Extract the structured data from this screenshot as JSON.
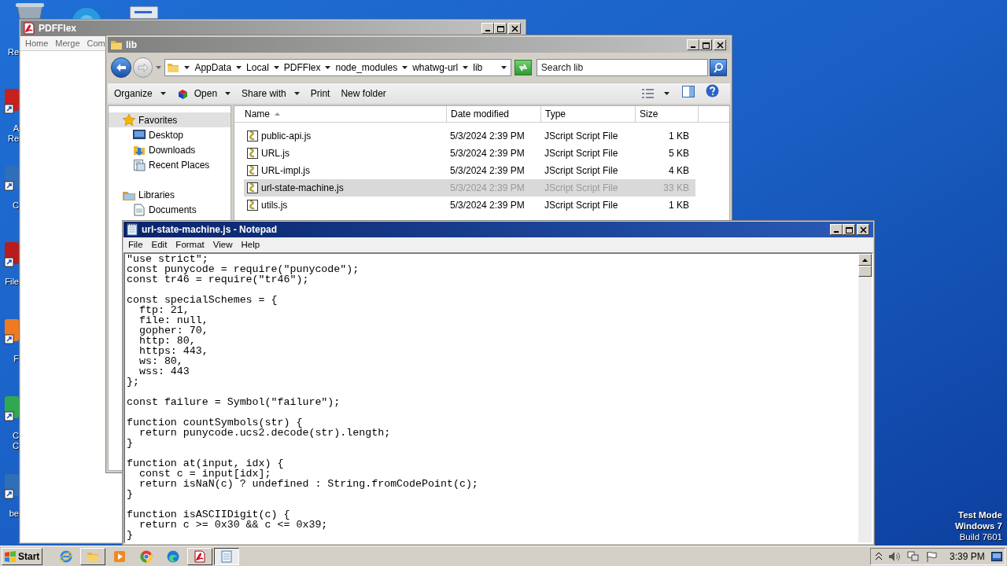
{
  "desktop": {
    "icons": [
      {
        "lines": [
          "Re"
        ]
      },
      {
        "lines": [
          "A",
          "Re"
        ]
      },
      {
        "lines": [
          "C"
        ]
      },
      {
        "lines": [
          "File"
        ]
      },
      {
        "lines": [
          "F"
        ]
      },
      {
        "lines": [
          "C",
          "C"
        ]
      },
      {
        "lines": [
          "be"
        ]
      }
    ],
    "notice": [
      "Test Mode",
      "Windows 7",
      "Build 7601"
    ]
  },
  "pdf_window": {
    "title": "PDFFlex",
    "tabs": [
      "Home",
      "Merge",
      "Com"
    ]
  },
  "explorer": {
    "title": "lib",
    "breadcrumb": [
      "AppData",
      "Local",
      "PDFFlex",
      "node_modules",
      "whatwg-url",
      "lib"
    ],
    "search": {
      "placeholder": "Search lib"
    },
    "toolbar": [
      {
        "label": "Organize",
        "dropdown": true
      },
      {
        "label": "Open",
        "dropdown": true
      },
      {
        "label": "Share with",
        "dropdown": true
      },
      {
        "label": "Print",
        "dropdown": false
      },
      {
        "label": "New folder",
        "dropdown": false
      }
    ],
    "nav": [
      {
        "label": "Favorites",
        "kind": "header",
        "selected": true
      },
      {
        "label": "Desktop",
        "kind": "item",
        "selected": false
      },
      {
        "label": "Downloads",
        "kind": "item",
        "selected": false
      },
      {
        "label": "Recent Places",
        "kind": "item",
        "selected": false
      },
      {
        "label": "Libraries",
        "kind": "header",
        "selected": false
      },
      {
        "label": "Documents",
        "kind": "item",
        "selected": false
      }
    ],
    "columns": [
      "Name",
      "Date modified",
      "Type",
      "Size"
    ],
    "rows": [
      {
        "name": "public-api.js",
        "date": "5/3/2024 2:39 PM",
        "type": "JScript Script File",
        "size": "1 KB",
        "selected": false
      },
      {
        "name": "URL.js",
        "date": "5/3/2024 2:39 PM",
        "type": "JScript Script File",
        "size": "5 KB",
        "selected": false
      },
      {
        "name": "URL-impl.js",
        "date": "5/3/2024 2:39 PM",
        "type": "JScript Script File",
        "size": "4 KB",
        "selected": false
      },
      {
        "name": "url-state-machine.js",
        "date": "5/3/2024 2:39 PM",
        "type": "JScript Script File",
        "size": "33 KB",
        "selected": true
      },
      {
        "name": "utils.js",
        "date": "5/3/2024 2:39 PM",
        "type": "JScript Script File",
        "size": "1 KB",
        "selected": false
      }
    ]
  },
  "notepad": {
    "title": "url-state-machine.js - Notepad",
    "menu": [
      "File",
      "Edit",
      "Format",
      "View",
      "Help"
    ],
    "text": "\"use strict\";\nconst punycode = require(\"punycode\");\nconst tr46 = require(\"tr46\");\n\nconst specialSchemes = {\n  ftp: 21,\n  file: null,\n  gopher: 70,\n  http: 80,\n  https: 443,\n  ws: 80,\n  wss: 443\n};\n\nconst failure = Symbol(\"failure\");\n\nfunction countSymbols(str) {\n  return punycode.ucs2.decode(str).length;\n}\n\nfunction at(input, idx) {\n  const c = input[idx];\n  return isNaN(c) ? undefined : String.fromCodePoint(c);\n}\n\nfunction isASCIIDigit(c) {\n  return c >= 0x30 && c <= 0x39;\n}"
  },
  "taskbar": {
    "start": "Start",
    "apps": [
      {
        "kind": "ie",
        "open": false,
        "selected": false
      },
      {
        "kind": "folder",
        "open": true,
        "selected": false
      },
      {
        "kind": "media",
        "open": false,
        "selected": false
      },
      {
        "kind": "chrome",
        "open": false,
        "selected": false
      },
      {
        "kind": "edge",
        "open": false,
        "selected": false
      },
      {
        "kind": "pdf",
        "open": true,
        "selected": false
      },
      {
        "kind": "notepad",
        "open": true,
        "selected": true
      }
    ],
    "clock": "3:39 PM"
  }
}
